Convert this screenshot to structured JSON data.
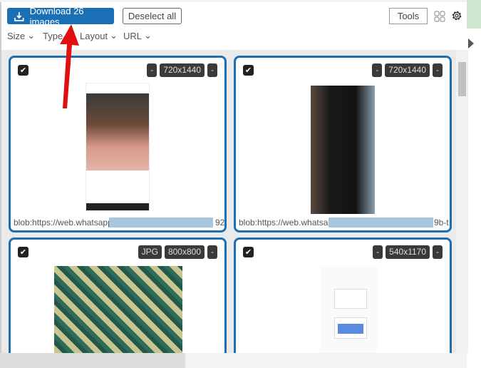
{
  "toolbar": {
    "download_label": "Download 26 images",
    "deselect_label": "Deselect all",
    "tools_label": "Tools"
  },
  "filters": [
    {
      "label": "Size"
    },
    {
      "label": "Type"
    },
    {
      "label": "Layout"
    },
    {
      "label": "URL"
    }
  ],
  "cards": [
    {
      "tags": [
        "-",
        "720x1440",
        "-"
      ],
      "url": "blob:https://web.whatsapp.c",
      "url_end": "92"
    },
    {
      "tags": [
        "-",
        "720x1440",
        "-"
      ],
      "url": "blob:https://web.whatsapp",
      "url_end": "9b-t"
    },
    {
      "tags": [
        "JPG",
        "800x800",
        "-"
      ],
      "url": "",
      "url_end": ""
    },
    {
      "tags": [
        "-",
        "540x1170",
        "-"
      ],
      "url": "",
      "url_end": ""
    }
  ],
  "colors": {
    "accent": "#1a6fb5",
    "arrow": "#e01010"
  }
}
